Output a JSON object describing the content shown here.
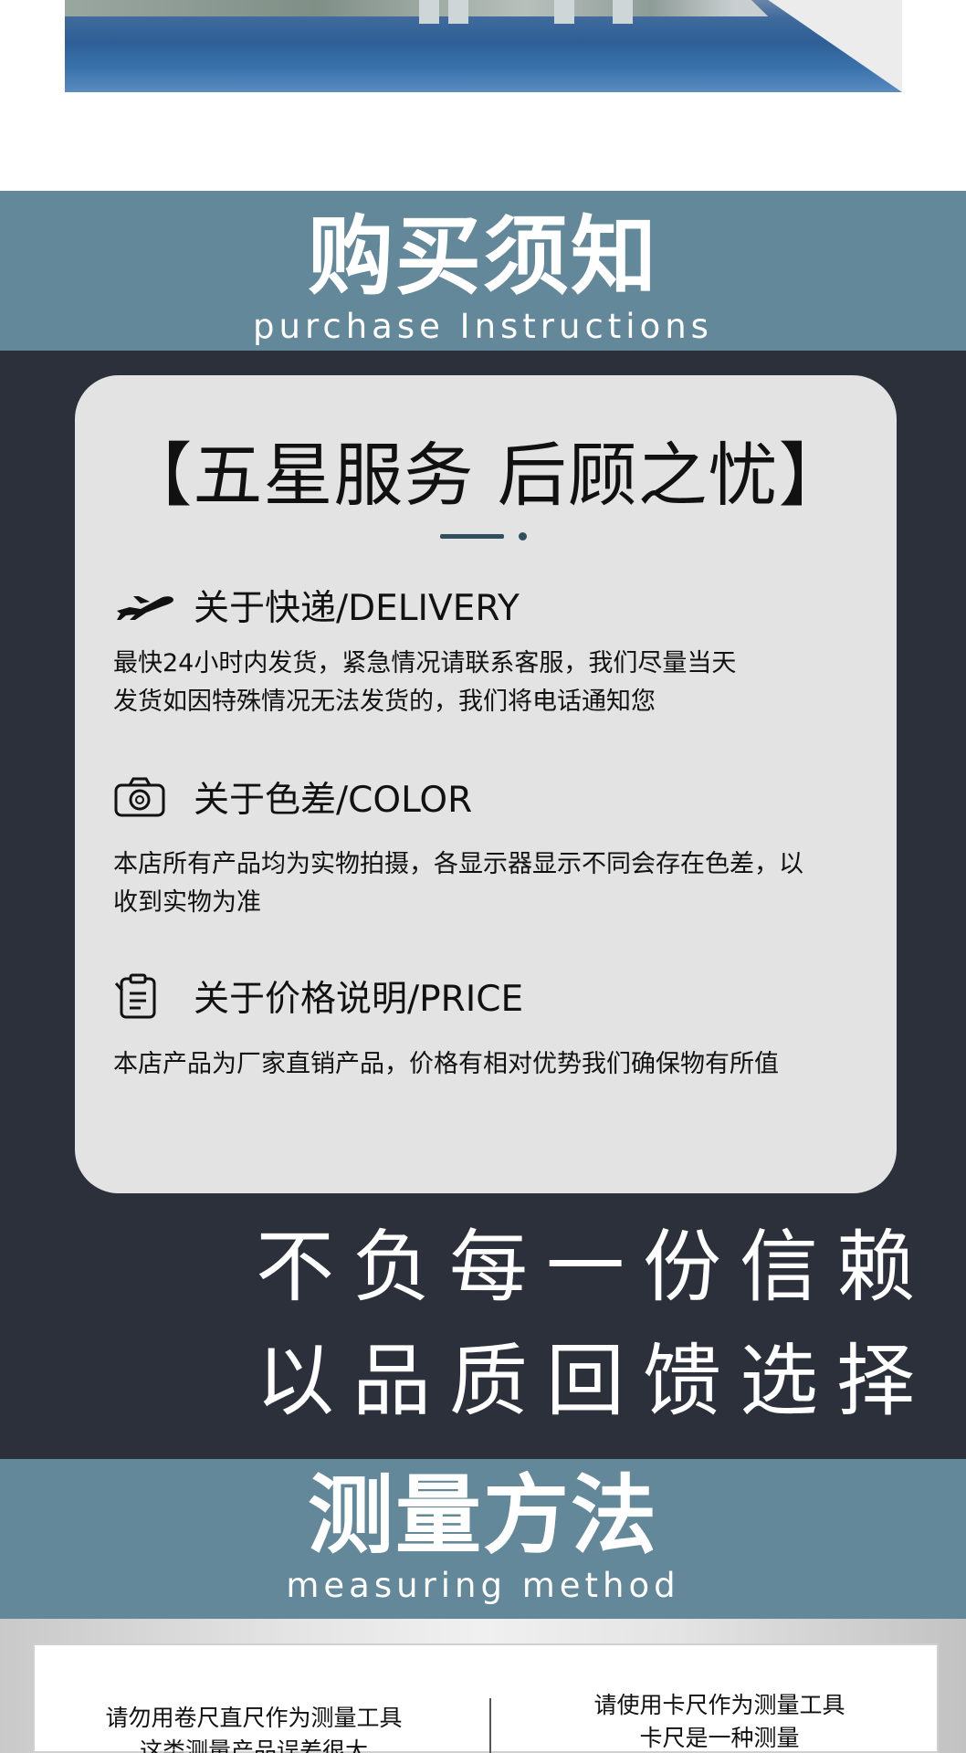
{
  "purchase": {
    "title_cn": "购买须知",
    "title_en": "purchase Instructions"
  },
  "card": {
    "title": "【五星服务  后顾之忧】",
    "sections": [
      {
        "icon": "airplane-icon",
        "title": "关于快递/DELIVERY",
        "body_line1": "最快24小时内发货，紧急情况请联系客服，我们尽量当天",
        "body_line2": "发货如因特殊情况无法发货的，我们将电话通知您"
      },
      {
        "icon": "camera-icon",
        "title": "关于色差/COLOR",
        "body_line1": "本店所有产品均为实物拍摄，各显示器显示不同会存在色差，以",
        "body_line2": "收到实物为准"
      },
      {
        "icon": "clipboard-icon",
        "title": "关于价格说明/PRICE",
        "body_line1": "本店产品为厂家直销产品，价格有相对优势我们确保物有所值"
      }
    ]
  },
  "slogan": {
    "line1": "不负每一份信赖",
    "line2": "以品质回馈选择"
  },
  "measure": {
    "title_cn": "测量方法",
    "title_en": "measuring method",
    "left_line1": "请勿用卷尺直尺作为测量工具",
    "left_line2": "这类测量产品误差很大",
    "right_line1": "请使用卡尺作为测量工具",
    "right_line2": "卡尺是一种测量"
  },
  "colors": {
    "band": "#62889a",
    "dark_bg": "#2b303a",
    "card_bg": "#e3e3e3",
    "divider": "#2f4f5e"
  }
}
